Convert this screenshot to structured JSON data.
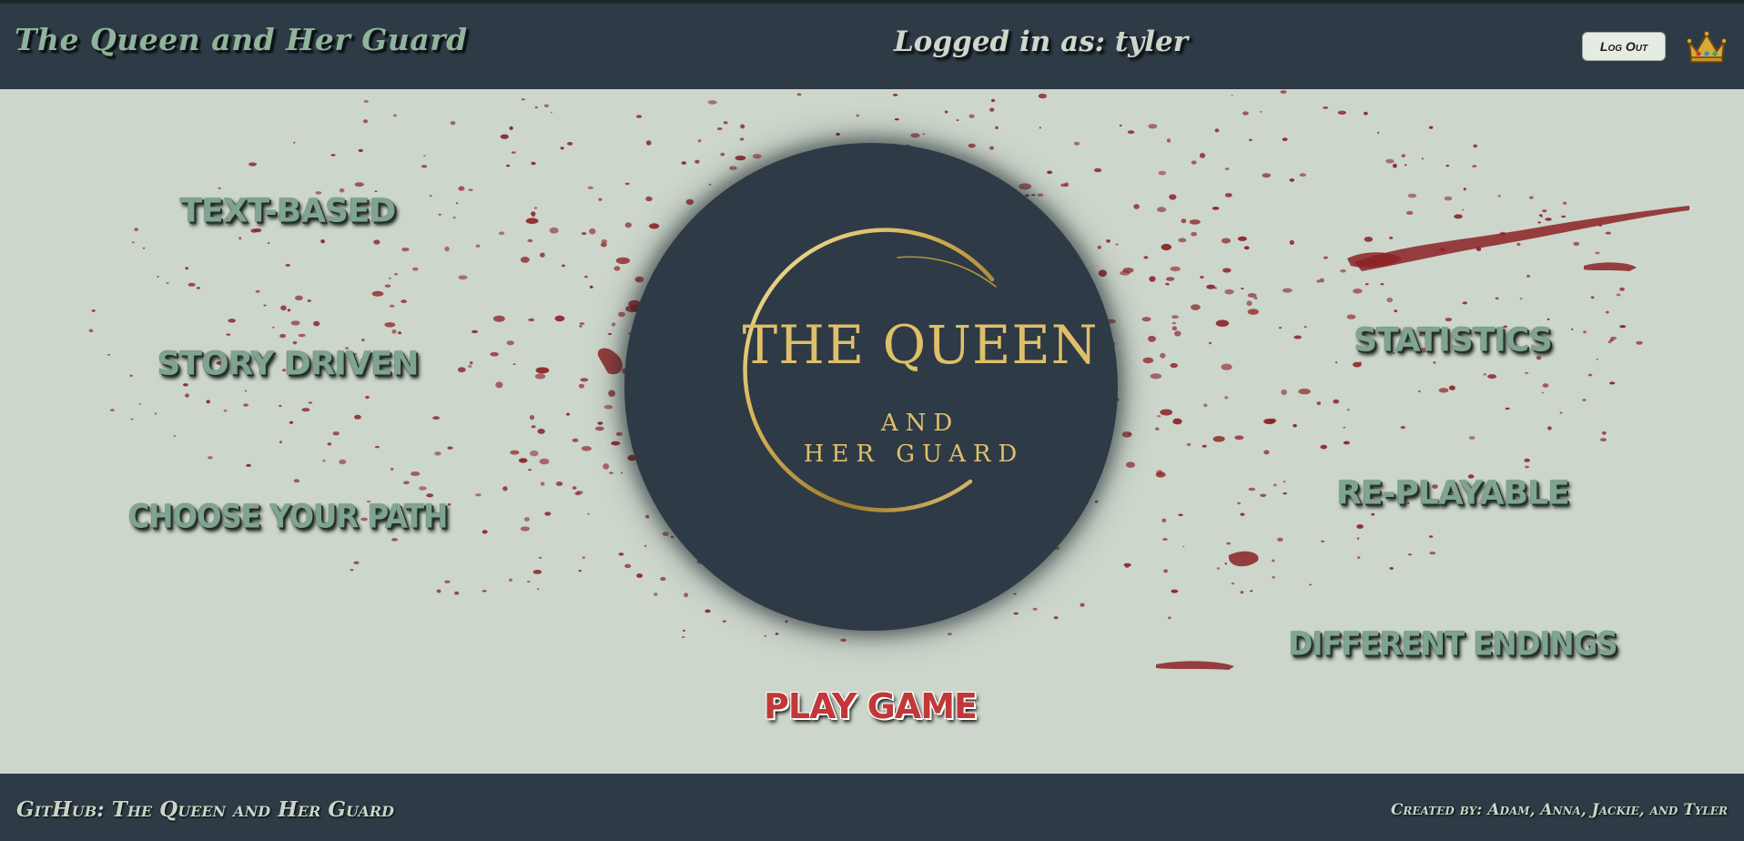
{
  "header": {
    "site_title": "The Queen and Her Guard",
    "login_status": "Logged in as: tyler",
    "logout_label": "Log Out",
    "crown_icon": "crown-icon"
  },
  "features_left": [
    {
      "label": "TEXT-BASED"
    },
    {
      "label": "STORY DRIVEN"
    },
    {
      "label": "CHOOSE YOUR PATH"
    }
  ],
  "features_right": [
    {
      "label": "STATISTICS"
    },
    {
      "label": "RE-PLAYABLE"
    },
    {
      "label": "DIFFERENT ENDINGS"
    }
  ],
  "logo": {
    "line1": "THE QUEEN",
    "line2": "AND",
    "line3": "HER GUARD"
  },
  "play_label": "PLAY GAME",
  "footer": {
    "github_label": "GitHub: The Queen and Her Guard",
    "credits": "Created by: Adam, Anna, Jackie, and Tyler"
  },
  "colors": {
    "header_bg": "#2e3a45",
    "page_bg": "#cdd6cb",
    "feature_text": "#7fa490",
    "blood": "#8b2226",
    "gold": "#d8b45a"
  }
}
